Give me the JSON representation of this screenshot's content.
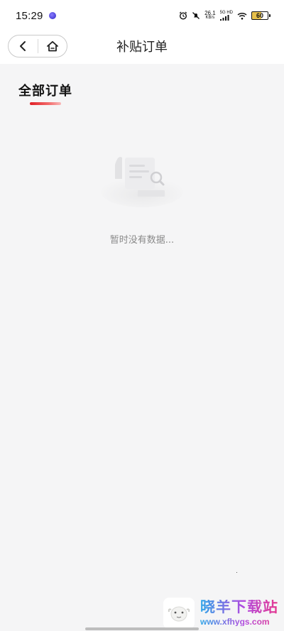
{
  "status_bar": {
    "time": "15:29",
    "net_speed": "26.1",
    "net_unit": "KB/s",
    "signal_label": "5G HD",
    "battery": "60",
    "icons": [
      "app-notification-icon",
      "alarm-icon",
      "mute-icon",
      "signal-icon",
      "wifi-icon",
      "battery-icon"
    ]
  },
  "nav": {
    "title": "补贴订单",
    "back_icon": "chevron-left-icon",
    "home_icon": "home-icon"
  },
  "tabs": [
    {
      "label": "全部订单",
      "active": true
    }
  ],
  "empty_state": {
    "message": "暂时没有数据...",
    "icon": "empty-document-search-icon"
  },
  "watermark": {
    "title": "晓羊下载站",
    "url": "www.xfhygs.com"
  },
  "colors": {
    "accent": "#e01f26",
    "background": "#f5f5f6",
    "header": "#ffffff",
    "muted_text": "#8a8a8a"
  }
}
